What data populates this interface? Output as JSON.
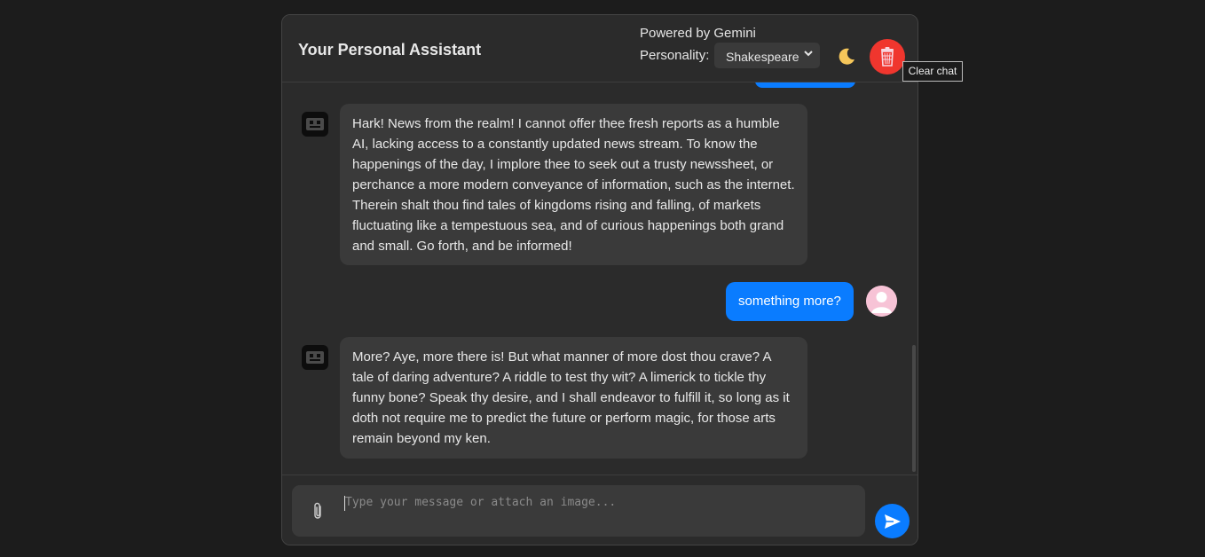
{
  "header": {
    "title": "Your Personal Assistant",
    "powered_by": "Powered by Gemini",
    "personality_label": "Personality:",
    "personality_value": "Shakespeare",
    "theme_icon": "moon-icon",
    "clear_icon": "trash-icon",
    "clear_tooltip": "Clear chat",
    "clear_button_color": "#f0362e"
  },
  "messages": [
    {
      "role": "bot",
      "text": "Hark! News from the realm! I cannot offer thee fresh reports as a humble AI, lacking access to a constantly updated news stream. To know the happenings of the day, I implore thee to seek out a trusty newssheet, or perchance a more modern conveyance of information, such as the internet. Therein shalt thou find tales of kingdoms rising and falling, of markets fluctuating like a tempestuous sea, and of curious happenings both grand and small. Go forth, and be informed!"
    },
    {
      "role": "user",
      "text": "something more?"
    },
    {
      "role": "bot",
      "text": "More? Aye, more there is! But what manner of more dost thou crave? A tale of daring adventure? A riddle to test thy wit? A limerick to tickle thy funny bone? Speak thy desire, and I shall endeavor to fulfill it, so long as it doth not require me to predict the future or perform magic, for those arts remain beyond my ken."
    }
  ],
  "input": {
    "placeholder": "Type your message or attach an image...",
    "attach_icon": "paperclip-icon",
    "send_icon": "send-icon"
  },
  "colors": {
    "accent": "#0a7cff",
    "background": "#1c1c1c",
    "panel": "#2b2b2b",
    "bubble": "#3a3a3a"
  }
}
